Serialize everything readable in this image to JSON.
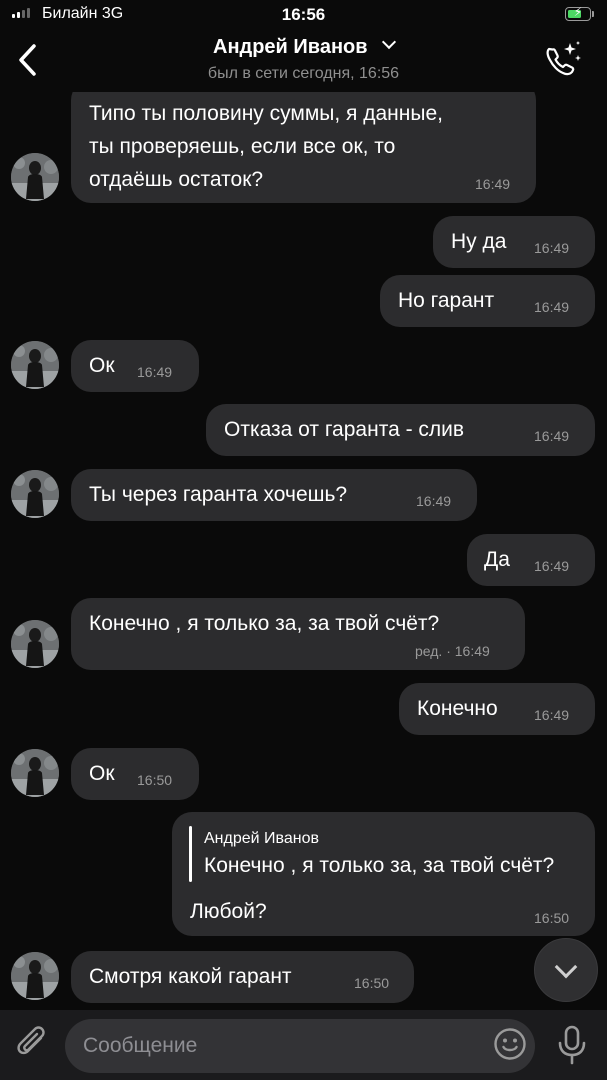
{
  "status_bar": {
    "carrier": "Билайн 3G",
    "time": "16:56",
    "battery_level": 0.7,
    "battery_color": "#4cd964"
  },
  "header": {
    "name": "Андрей Иванов",
    "last_seen": "был в сети сегодня, 16:56",
    "back_icon": "chevron-left-icon",
    "call_icon": "phone-sparkle-icon"
  },
  "messages": [
    {
      "side": "in",
      "lines": [
        "Типо ты половину суммы, я данные,",
        "ты проверяешь, если все ок, то",
        "отдаёшь остаток?"
      ],
      "time": "16:49"
    },
    {
      "side": "out",
      "text": "Ну да",
      "time": "16:49"
    },
    {
      "side": "out",
      "text": "Но гарант",
      "time": "16:49"
    },
    {
      "side": "in",
      "text": "Ок",
      "time": "16:49"
    },
    {
      "side": "out",
      "text": "Отказа от гаранта - слив",
      "time": "16:49"
    },
    {
      "side": "in",
      "text": "Ты через гаранта хочешь?",
      "time": "16:49"
    },
    {
      "side": "out",
      "text": "Да",
      "time": "16:49"
    },
    {
      "side": "in",
      "text": "Конечно , я только за, за твой счёт?",
      "time": "ред. · 16:49"
    },
    {
      "side": "out",
      "text": "Конечно",
      "time": "16:49"
    },
    {
      "side": "in",
      "text": "Ок",
      "time": "16:50"
    },
    {
      "side": "out",
      "reply_name": "Андрей Иванов",
      "reply_text": "Конечно , я только за, за твой счёт?",
      "text": "Любой?",
      "time": "16:50"
    },
    {
      "side": "in",
      "text": "Смотря какой гарант",
      "time": "16:50"
    }
  ],
  "composer": {
    "placeholder": "Сообщение",
    "attach_icon": "paperclip-icon",
    "emoji_icon": "smile-icon",
    "mic_icon": "microphone-icon"
  },
  "colors": {
    "background": "#0a0a0a",
    "bubble": "#2c2c2e",
    "composer": "#1b1b1d"
  }
}
